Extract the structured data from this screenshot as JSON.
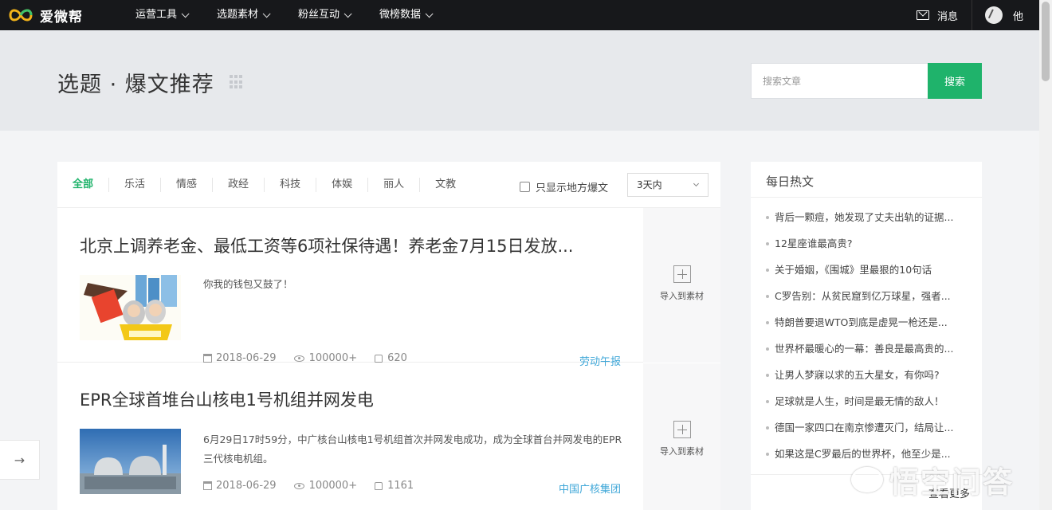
{
  "nav": {
    "logo_text": "爱微帮",
    "items": [
      {
        "label": "运营工具"
      },
      {
        "label": "选题素材"
      },
      {
        "label": "粉丝互动"
      },
      {
        "label": "微榜数据"
      }
    ],
    "messages_label": "消息",
    "user_name": "他"
  },
  "header": {
    "title": "选题 · 爆文推荐",
    "search_placeholder": "搜索文章",
    "search_button": "搜索"
  },
  "filters": {
    "categories": [
      {
        "label": "全部",
        "active": true
      },
      {
        "label": "乐活",
        "active": false
      },
      {
        "label": "情感",
        "active": false
      },
      {
        "label": "政经",
        "active": false
      },
      {
        "label": "科技",
        "active": false
      },
      {
        "label": "体娱",
        "active": false
      },
      {
        "label": "丽人",
        "active": false
      },
      {
        "label": "文教",
        "active": false
      }
    ],
    "local_only_label": "只显示地方爆文",
    "local_only_checked": false,
    "time_range": "3天内"
  },
  "articles": [
    {
      "title": "北京上调养老金、最低工资等6项社保待遇！养老金7月15日发放...",
      "summary": "你我的钱包又鼓了！",
      "date": "2018-06-29",
      "views": "100000+",
      "likes": "620",
      "source": "劳动午报",
      "import_label": "导入到素材"
    },
    {
      "title": "EPR全球首堆台山核电1号机组并网发电",
      "summary": "6月29日17时59分，中广核台山核电1号机组首次并网发电成功，成为全球首台并网发电的EPR三代核电机组。",
      "date": "2018-06-29",
      "views": "100000+",
      "likes": "1161",
      "source": "中国广核集团",
      "import_label": "导入到素材"
    }
  ],
  "hot": {
    "title": "每日热文",
    "items": [
      "背后一颗痘，她发现了丈夫出轨的证据...",
      "12星座谁最高贵?",
      "关于婚姻，《围城》里最狠的10句话",
      "C罗告别：从贫民窟到亿万球星，强者...",
      "特朗普要退WTO到底是虚晃一枪还是...",
      "世界杯最暖心的一幕：善良是最高贵的...",
      "让男人梦寐以求的五大星女，有你吗?",
      "足球就是人生，时间是最无情的敌人！",
      "德国一家四口在南京惨遭灭门，结局让...",
      "如果这是C罗最后的世界杯，他至少是..."
    ],
    "more_label": "查看更多"
  },
  "watermark": "悟空问答",
  "colors": {
    "nav_bg": "#17181b",
    "accent_green": "#1fb36b",
    "source_blue": "#3fa7d8"
  }
}
